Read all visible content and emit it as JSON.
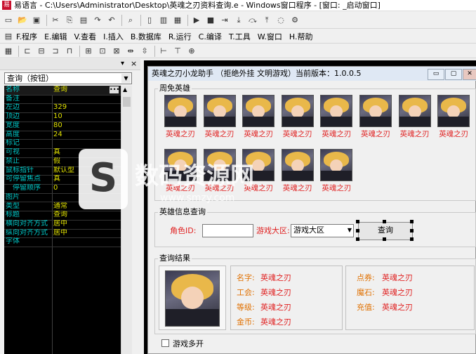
{
  "ide": {
    "title": "易语言 - C:\\Users\\Administrator\\Desktop\\英魂之刃资料查询.e - Windows窗口程序 - [窗口: _启动窗口]",
    "logo_glyph": "易"
  },
  "toolbar1": [
    "new-file-icon",
    "open-icon",
    "save-icon",
    "cut-icon",
    "copy-icon",
    "paste-icon",
    "redo-icon",
    "undo-icon",
    "find-icon",
    "window-icon",
    "layout-icon",
    "layout2-icon",
    "run-icon",
    "stop-icon",
    "step-icon",
    "step-into-icon",
    "step-over-icon",
    "step-out-icon",
    "break-icon",
    "debug-icon"
  ],
  "menu": [
    {
      "label": "F.程序"
    },
    {
      "label": "E.编辑"
    },
    {
      "label": "V.查看"
    },
    {
      "label": "I.插入"
    },
    {
      "label": "B.数据库"
    },
    {
      "label": "R.运行"
    },
    {
      "label": "C.编译"
    },
    {
      "label": "T.工具"
    },
    {
      "label": "W.窗口"
    },
    {
      "label": "H.帮助"
    }
  ],
  "left": {
    "panel_close": "×",
    "combo_value": "查询（按钮）",
    "properties": [
      {
        "name": "名称",
        "value": "查询"
      },
      {
        "name": "备注",
        "value": ""
      },
      {
        "name": "左边",
        "value": "329"
      },
      {
        "name": "顶边",
        "value": "10"
      },
      {
        "name": "宽度",
        "value": "80"
      },
      {
        "name": "高度",
        "value": "24"
      },
      {
        "name": "标记",
        "value": ""
      },
      {
        "name": "可视",
        "value": "真"
      },
      {
        "name": "禁止",
        "value": "假"
      },
      {
        "name": "鼠标指针",
        "value": "默认型"
      },
      {
        "name": "可停留焦点",
        "value": "真"
      },
      {
        "name": "停留顺序",
        "value": "0"
      },
      {
        "name": "图片",
        "value": ""
      },
      {
        "name": "类型",
        "value": "通常"
      },
      {
        "name": "标题",
        "value": "查询"
      },
      {
        "name": "横向对齐方式",
        "value": "居中"
      },
      {
        "name": "纵向对齐方式",
        "value": "居中"
      },
      {
        "name": "字体",
        "value": ""
      }
    ]
  },
  "window": {
    "title": "英魂之刃小龙助手  （拒绝外挂 文明游戏）当前版本：1.0.0.5",
    "minimize": "▭",
    "maximize": "▢",
    "close": "✕",
    "free_heroes": {
      "title": "周免英雄",
      "heroes": [
        "英魂之刃",
        "英魂之刃",
        "英魂之刃",
        "英魂之刃",
        "英魂之刃",
        "英魂之刃",
        "英魂之刃",
        "英魂之刃",
        "英魂之刃",
        "英魂之刃",
        "英魂之刃",
        "英魂之刃",
        "英魂之刃"
      ]
    },
    "query": {
      "title": "英雄信息查询",
      "role_label": "角色ID:",
      "role_value": "",
      "server_label": "游戏大区:",
      "server_value": "游戏大区",
      "query_button": "查询"
    },
    "result": {
      "title": "查询结果",
      "fields": [
        {
          "label": "名字:",
          "value": "英魂之刃"
        },
        {
          "label": "工会:",
          "value": "英魂之刃"
        },
        {
          "label": "等级:",
          "value": "英魂之刃"
        },
        {
          "label": "金币:",
          "value": "英魂之刃"
        }
      ],
      "fields2": [
        {
          "label": "点券:",
          "value": "英魂之刃"
        },
        {
          "label": "魔石:",
          "value": "英魂之刃"
        },
        {
          "label": "充值:",
          "value": "英魂之刃"
        }
      ]
    },
    "multi_open": "游戏多开"
  },
  "watermark": {
    "text": "数码资源网",
    "sub": "www.smzy.com"
  }
}
